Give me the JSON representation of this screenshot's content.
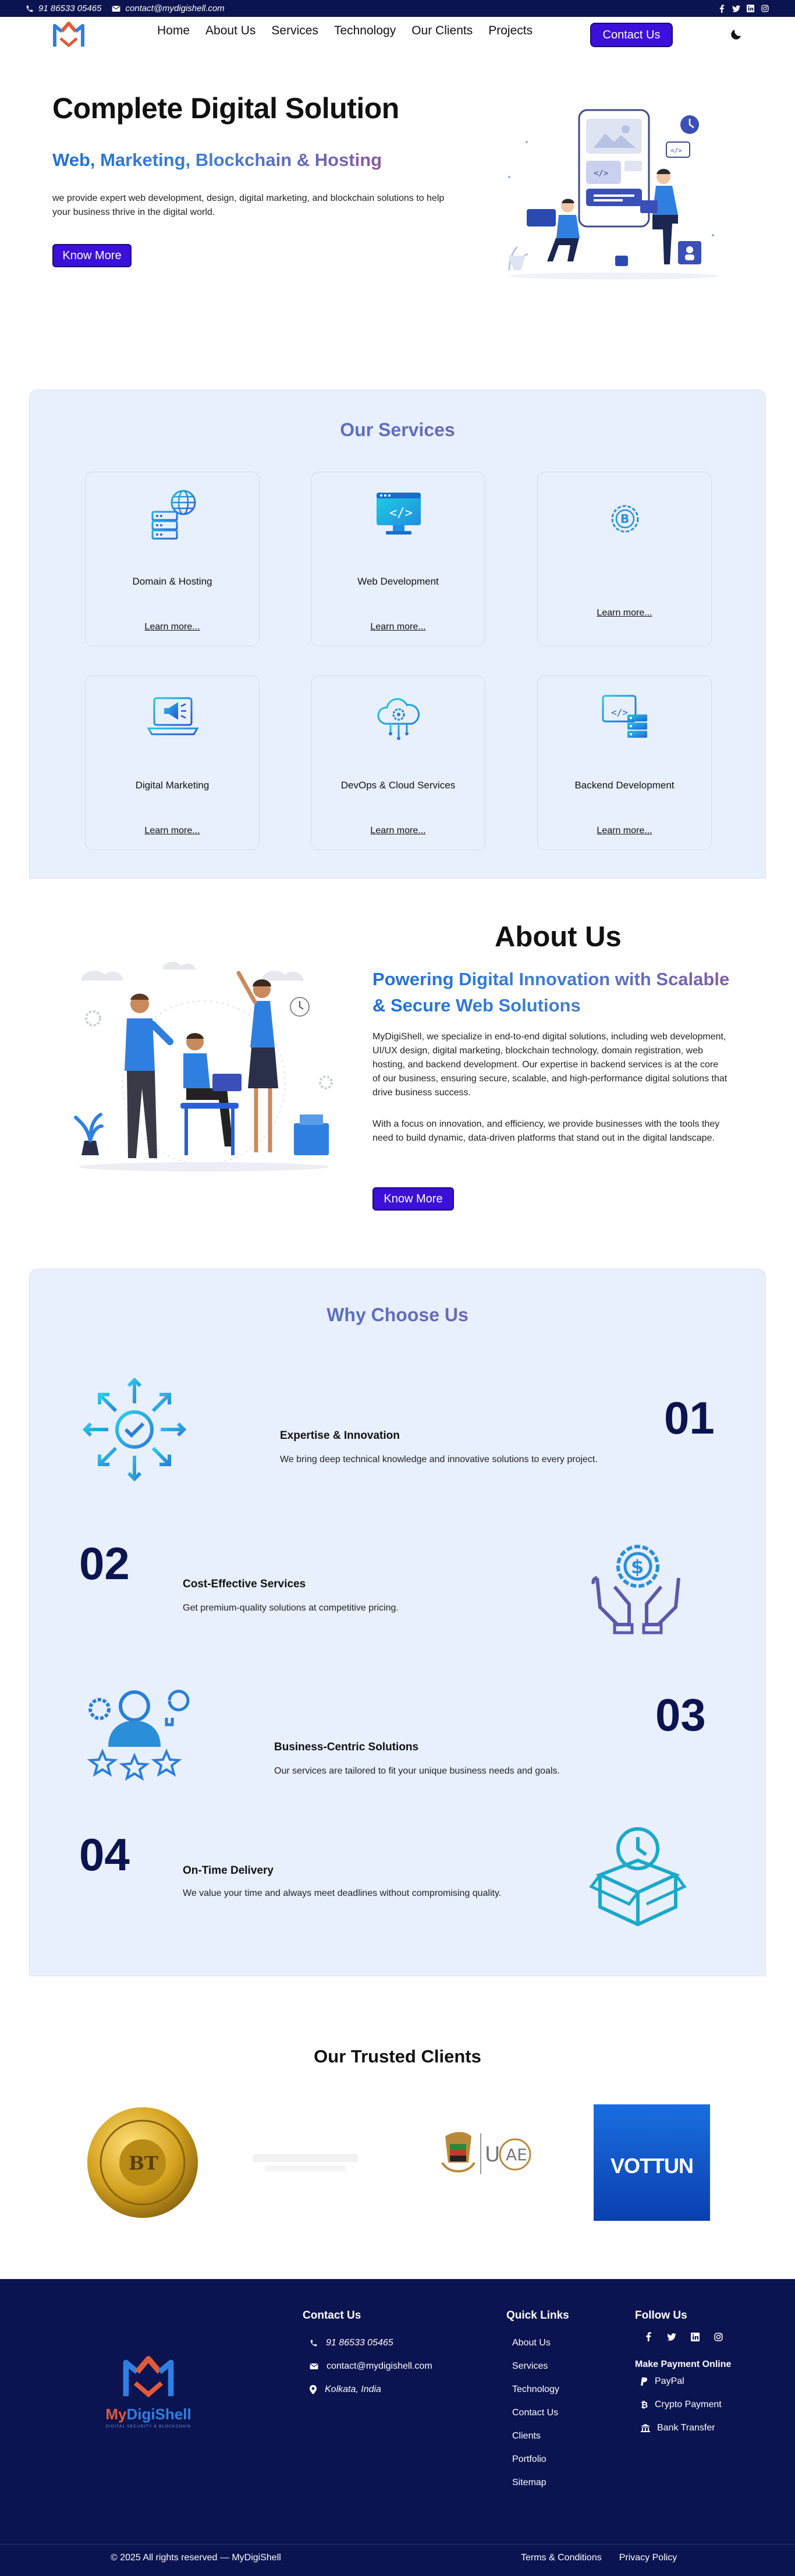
{
  "topbar": {
    "phone": "91 86533 05465",
    "email": "contact@mydigishell.com",
    "social_icons": [
      "facebook-icon",
      "twitter-icon",
      "linkedin-icon",
      "instagram-icon"
    ]
  },
  "nav": {
    "items": [
      "Home",
      "About Us",
      "Services",
      "Technology",
      "Our Clients",
      "Projects"
    ],
    "contact_button": "Contact Us"
  },
  "hero": {
    "title": "Complete Digital Solution",
    "subtitle": "Web, Marketing, Blockchain & Hosting",
    "description": "we provide expert web development, design, digital marketing, and blockchain solutions to help your business thrive in the digital world.",
    "button": "Know More"
  },
  "services": {
    "title": "Our Services",
    "cards": [
      {
        "title": "Domain & Hosting",
        "link": "Learn more...",
        "icon": "server-globe-icon"
      },
      {
        "title": "Web Development",
        "link": "Learn more...",
        "icon": "code-monitor-icon"
      },
      {
        "title": "",
        "link": "Learn more...",
        "icon": "bitcoin-icon"
      },
      {
        "title": "Digital Marketing",
        "link": "Learn more...",
        "icon": "megaphone-laptop-icon"
      },
      {
        "title": "DevOps & Cloud Services",
        "link": "Learn more...",
        "icon": "cloud-gear-icon"
      },
      {
        "title": "Backend Development",
        "link": "Learn more...",
        "icon": "backend-server-icon"
      }
    ]
  },
  "about": {
    "title": "About Us",
    "subtitle": "Powering Digital Innovation with Scalable & Secure Web Solutions",
    "para1": "MyDigiShell, we specialize in end-to-end digital solutions, including web development, UI/UX design, digital marketing, blockchain technology, domain registration, web hosting, and backend development. Our expertise in backend services is at the core of our business, ensuring secure, scalable, and high-performance digital solutions that drive business success.",
    "para2": "With a focus on innovation, and efficiency, we provide businesses with the tools they need to build dynamic, data-driven platforms that stand out in the digital landscape.",
    "button": "Know More"
  },
  "why": {
    "title": "Why Choose Us",
    "reasons": [
      {
        "number": "01",
        "title": "Expertise & Innovation",
        "description": "We bring deep technical knowledge and innovative solutions to every project.",
        "icon": "target-arrows-icon"
      },
      {
        "number": "02",
        "title": "Cost-Effective Services",
        "description": "Get premium-quality solutions at competitive pricing.",
        "icon": "hands-dollar-gear-icon"
      },
      {
        "number": "03",
        "title": "Business-Centric Solutions",
        "description": "Our services are tailored to fit your unique business needs and goals.",
        "icon": "team-stars-icon"
      },
      {
        "number": "04",
        "title": "On-Time Delivery",
        "description": "We value your time and always meet deadlines without compromising quality.",
        "icon": "box-clock-icon"
      }
    ]
  },
  "clients": {
    "title": "Our Trusted Clients",
    "logo_icons": [
      "gold-coin-logo-icon",
      "faded-wordmark-logo-icon",
      "uae-emblem-logo-icon",
      "vottun-logo-icon"
    ],
    "vottun_text": "VOTTUN"
  },
  "footer": {
    "brand": "MyDigiShell",
    "tagline": "DIGITAL SECURITY & BLOCKCHAIN",
    "contact_title": "Contact Us",
    "phone": "91 86533 05465",
    "email": "contact@mydigishell.com",
    "location": "Kolkata, India",
    "quick_links_title": "Quick Links",
    "quick_links": [
      "About Us",
      "Services",
      "Technology",
      "Contact Us",
      "Clients",
      "Portfolio",
      "Sitemap"
    ],
    "follow_title": "Follow Us",
    "payment_title": "Make Payment Online",
    "payments": [
      "PayPal",
      "Crypto Payment",
      "Bank Transfer"
    ],
    "copyright": "© 2025 All rights reserved — MyDigiShell",
    "terms": "Terms & Conditions",
    "privacy": "Privacy Policy"
  },
  "colors": {
    "navy": "#0b1450",
    "primary": "#3b10d8",
    "panel": "#e8effd",
    "accent_blue": "#1e6fd9",
    "accent_purple": "#8a5aa0"
  }
}
